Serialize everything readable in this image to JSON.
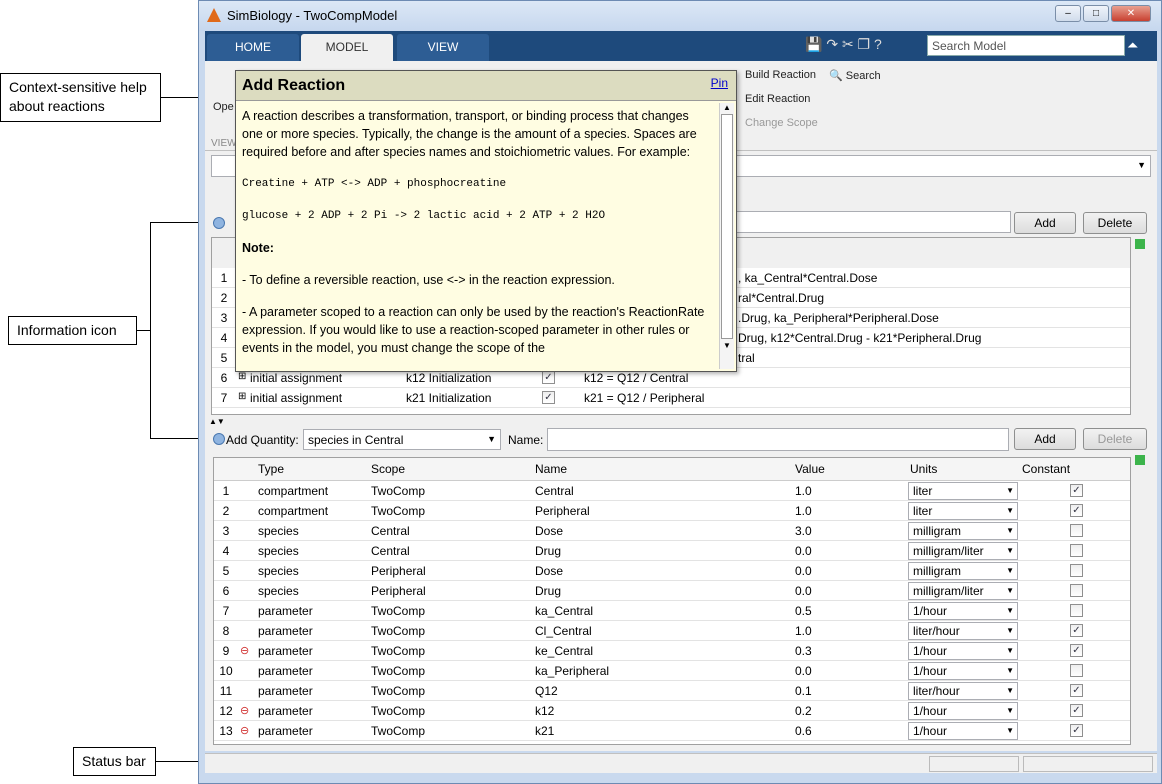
{
  "annotations": {
    "help": "Context-sensitive help about reactions",
    "info": "Information icon",
    "status": "Status bar"
  },
  "window": {
    "title": "SimBiology - TwoCompModel",
    "minimize": "–",
    "maximize": "□",
    "close": "✕"
  },
  "tabs": [
    {
      "label": "HOME"
    },
    {
      "label": "MODEL"
    },
    {
      "label": "VIEW"
    }
  ],
  "search": {
    "placeholder": "Search Model"
  },
  "ribbon": {
    "open": "Ope",
    "view_section": "VIEW",
    "build_reaction": "Build Reaction",
    "edit_reaction": "Edit Reaction",
    "change_scope": "Change Scope",
    "search": "Search"
  },
  "popup": {
    "title": "Add Reaction",
    "pin": "Pin",
    "intro": "A reaction describes a transformation, transport, or binding process that changes one or more species. Typically, the change is the amount of a species. Spaces are required before and after species names and stoichiometric values. For example:",
    "ex1": "Creatine + ATP <-> ADP + phosphocreatine",
    "ex2": "glucose + 2 ADP + 2 Pi -> 2 lactic acid + 2 ATP + 2 H2O",
    "note": "Note:",
    "bullet1": "- To define a reversible reaction, use <-> in the reaction expression.",
    "bullet2": "- A parameter scoped to a reaction can only be used by the reaction's ReactionRate expression. If you would like to use a reaction-scoped parameter in other rules or events in the model, you must change the scope of the"
  },
  "upper": {
    "add": "Add",
    "delete": "Delete",
    "rows": [
      {
        "n": "1",
        "expr": ", ka_Central*Central.Dose"
      },
      {
        "n": "2",
        "expr": "ral*Central.Drug"
      },
      {
        "n": "3",
        "expr": ".Drug, ka_Peripheral*Peripheral.Dose"
      },
      {
        "n": "4",
        "expr": "Drug, k12*Central.Drug - k21*Peripheral.Drug"
      },
      {
        "n": "5",
        "expr": "tral"
      },
      {
        "n": "6",
        "type": "initial assignment",
        "name": "k12 Initialization",
        "expr": "k12 = Q12 / Central"
      },
      {
        "n": "7",
        "type": "initial assignment",
        "name": "k21 Initialization",
        "expr": "k21 = Q12 / Peripheral"
      }
    ]
  },
  "quantity": {
    "label": "Add Quantity:",
    "selected": "species in Central",
    "name_label": "Name:",
    "add": "Add",
    "delete": "Delete"
  },
  "lower": {
    "headers": [
      "Type",
      "Scope",
      "Name",
      "Value",
      "Units",
      "Constant"
    ],
    "rows": [
      [
        "1",
        "",
        "compartment",
        "TwoComp",
        "Central",
        "1.0",
        "liter",
        true
      ],
      [
        "2",
        "",
        "compartment",
        "TwoComp",
        "Peripheral",
        "1.0",
        "liter",
        true
      ],
      [
        "3",
        "",
        "species",
        "Central",
        "Dose",
        "3.0",
        "milligram",
        false
      ],
      [
        "4",
        "",
        "species",
        "Central",
        "Drug",
        "0.0",
        "milligram/liter",
        false
      ],
      [
        "5",
        "",
        "species",
        "Peripheral",
        "Dose",
        "0.0",
        "milligram",
        false
      ],
      [
        "6",
        "",
        "species",
        "Peripheral",
        "Drug",
        "0.0",
        "milligram/liter",
        false
      ],
      [
        "7",
        "",
        "parameter",
        "TwoComp",
        "ka_Central",
        "0.5",
        "1/hour",
        false
      ],
      [
        "8",
        "",
        "parameter",
        "TwoComp",
        "Cl_Central",
        "1.0",
        "liter/hour",
        true
      ],
      [
        "9",
        "warn",
        "parameter",
        "TwoComp",
        "ke_Central",
        "0.3",
        "1/hour",
        true
      ],
      [
        "10",
        "",
        "parameter",
        "TwoComp",
        "ka_Peripheral",
        "0.0",
        "1/hour",
        false
      ],
      [
        "11",
        "",
        "parameter",
        "TwoComp",
        "Q12",
        "0.1",
        "liter/hour",
        true
      ],
      [
        "12",
        "warn",
        "parameter",
        "TwoComp",
        "k12",
        "0.2",
        "1/hour",
        true
      ],
      [
        "13",
        "warn",
        "parameter",
        "TwoComp",
        "k21",
        "0.6",
        "1/hour",
        true
      ]
    ]
  },
  "colors": {
    "tabband": "#1e4a7c",
    "popup_bg": "#fffde2",
    "warning": "#d03030",
    "ok": "#3cb44b"
  }
}
